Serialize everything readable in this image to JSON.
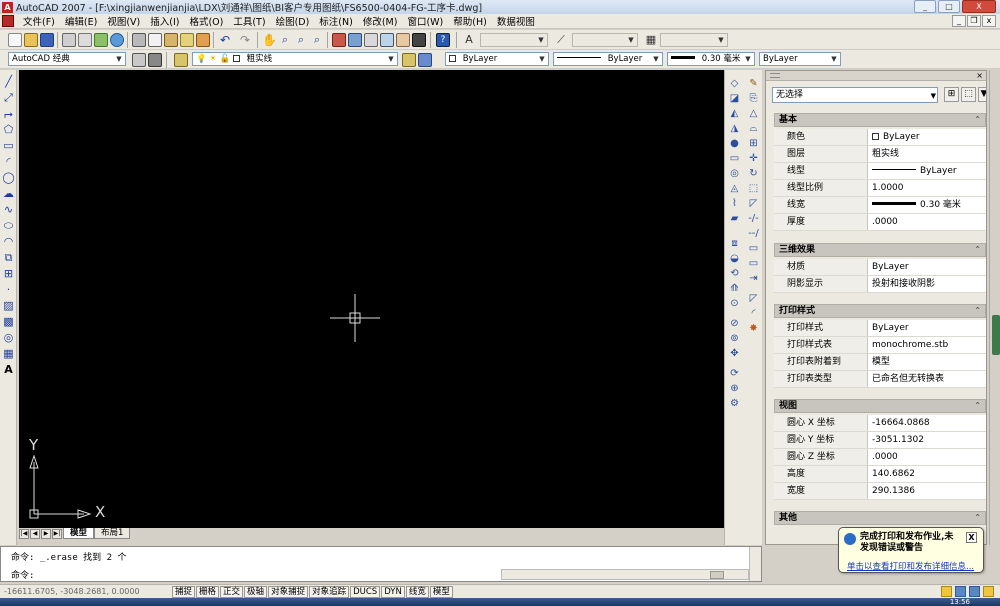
{
  "window": {
    "app_name": "AutoCAD 2007",
    "title": "AutoCAD 2007 - [F:\\xingjianwenjianjia\\LDX\\刘通祥\\图纸\\BI客户专用图纸\\FS6500-0404-FG-工序卡.dwg]",
    "minimize": "_",
    "maximize": "□",
    "close": "X"
  },
  "menu": {
    "items": [
      "文件(F)",
      "编辑(E)",
      "视图(V)",
      "插入(I)",
      "格式(O)",
      "工具(T)",
      "绘图(D)",
      "标注(N)",
      "修改(M)",
      "窗口(W)",
      "帮助(H)",
      "数据视图"
    ],
    "mdi_minimize": "_",
    "mdi_restore": "❐",
    "mdi_close": "x"
  },
  "toolbar": {
    "workspace": "AutoCAD 经典",
    "layer": "粗实线",
    "color": "ByLayer",
    "linetype": "ByLayer",
    "lineweight": "0.30 毫米",
    "plotstyle": "ByLayer"
  },
  "canvas": {
    "background": "#000000",
    "ucs_x": "X",
    "ucs_y": "Y"
  },
  "layout_tabs": [
    "模型",
    "布局1"
  ],
  "properties": {
    "selection": "无选择",
    "sections": [
      {
        "title": "基本",
        "rows": [
          {
            "name": "颜色",
            "value": "ByLayer",
            "swatch": true
          },
          {
            "name": "图层",
            "value": "粗实线"
          },
          {
            "name": "线型",
            "value": "ByLayer",
            "line": "thin"
          },
          {
            "name": "线型比例",
            "value": "1.0000"
          },
          {
            "name": "线宽",
            "value": "0.30 毫米",
            "line": "thick"
          },
          {
            "name": "厚度",
            "value": ".0000"
          }
        ]
      },
      {
        "title": "三维效果",
        "rows": [
          {
            "name": "材质",
            "value": "ByLayer"
          },
          {
            "name": "阴影显示",
            "value": "投射和接收阴影"
          }
        ]
      },
      {
        "title": "打印样式",
        "rows": [
          {
            "name": "打印样式",
            "value": "ByLayer"
          },
          {
            "name": "打印样式表",
            "value": "monochrome.stb"
          },
          {
            "name": "打印表附着到",
            "value": "模型"
          },
          {
            "name": "打印表类型",
            "value": "已命名但无转换表"
          }
        ]
      },
      {
        "title": "视图",
        "rows": [
          {
            "name": "圆心 X 坐标",
            "value": "-16664.0868"
          },
          {
            "name": "圆心 Y 坐标",
            "value": "-3051.1302"
          },
          {
            "name": "圆心 Z 坐标",
            "value": ".0000"
          },
          {
            "name": "高度",
            "value": "140.6862"
          },
          {
            "name": "宽度",
            "value": "290.1386"
          }
        ]
      },
      {
        "title": "其他",
        "rows": []
      }
    ]
  },
  "command": {
    "history": "命令:  _.erase 找到 2 个",
    "prompt": "命令:"
  },
  "status": {
    "coords": "-16611.6705, -3048.2681, 0.0000",
    "buttons": [
      "捕捉",
      "栅格",
      "正交",
      "极轴",
      "对象捕捉",
      "对象追踪",
      "DUCS",
      "DYN",
      "线宽",
      "模型"
    ]
  },
  "balloon": {
    "title": "完成打印和发布作业,未发现错误或警告",
    "link": "单击以查看打印和发布详细信息...",
    "close": "X"
  },
  "taskbar": {
    "clock": "13:56"
  }
}
